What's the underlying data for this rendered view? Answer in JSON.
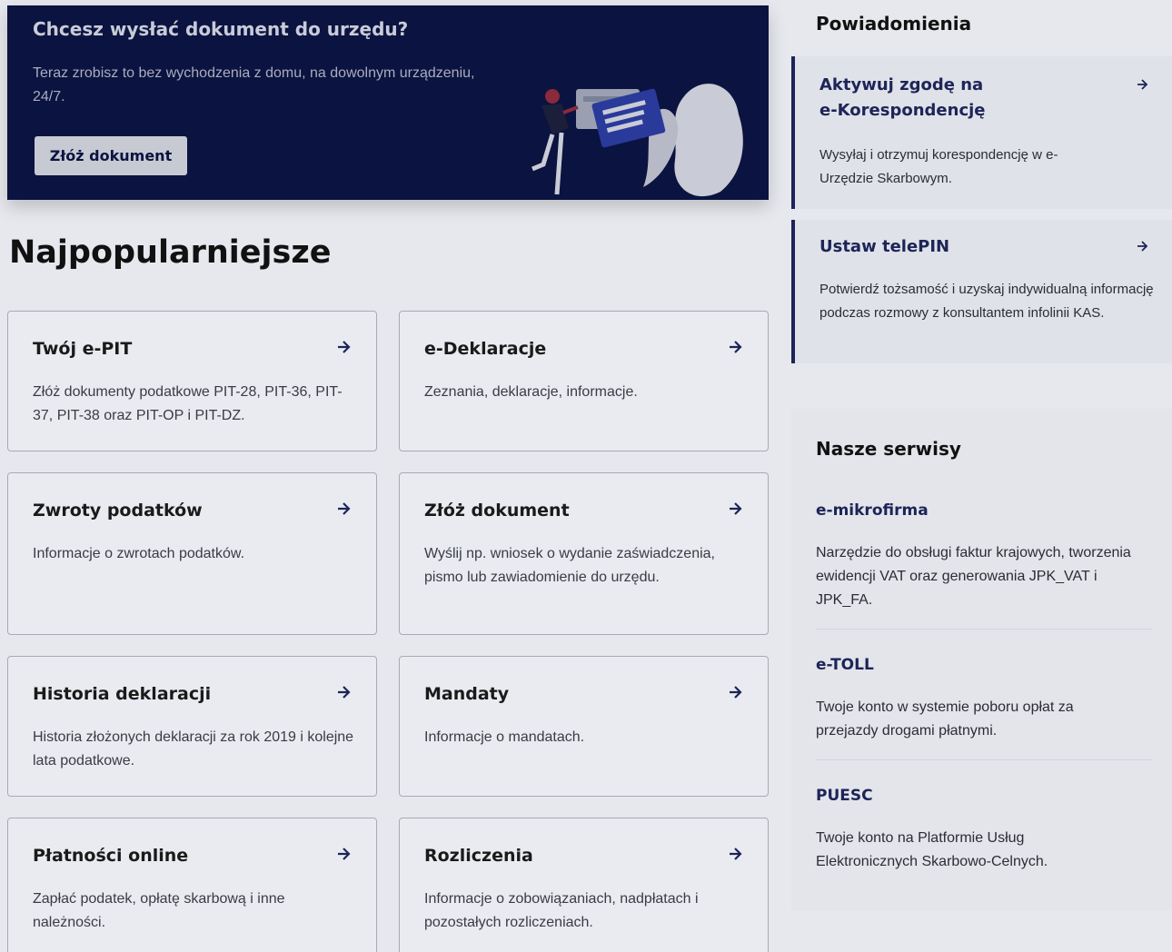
{
  "hero": {
    "title": "Chcesz wysłać dokument do urzędu?",
    "text": "Teraz zrobisz to bez wychodzenia z domu, na dowolnym urządzeniu, 24/7.",
    "button": "Złóż dokument"
  },
  "popular": {
    "title": "Najpopularniejsze",
    "cards": [
      {
        "title": "Twój e-PIT",
        "desc": "Złóż dokumenty podatkowe PIT-28, PIT-36, PIT-37, PIT-38 oraz PIT-OP i PIT-DZ."
      },
      {
        "title": "e-Deklaracje",
        "desc": "Zeznania, deklaracje, informacje."
      },
      {
        "title": "Zwroty podatków",
        "desc": "Informacje o zwrotach podatków."
      },
      {
        "title": "Złóż dokument",
        "desc": "Wyślij np. wniosek o wydanie zaświadczenia, pismo lub zawiadomienie do urzędu."
      },
      {
        "title": "Historia deklaracji",
        "desc": "Historia złożonych deklaracji za rok 2019 i kolejne lata podatkowe."
      },
      {
        "title": "Mandaty",
        "desc": "Informacje o mandatach."
      },
      {
        "title": "Płatności online",
        "desc": "Zapłać podatek, opłatę skarbową i inne należności."
      },
      {
        "title": "Rozliczenia",
        "desc": "Informacje o zobowiązaniach, nadpłatach i pozostałych rozliczeniach."
      }
    ]
  },
  "notifications": {
    "title": "Powiadomienia",
    "items": [
      {
        "title_line1": "Aktywuj zgodę na",
        "title_line2": "e-Korespondencję",
        "desc": "Wysyłaj i otrzymuj korespondencję w e-Urzędzie Skarbowym."
      },
      {
        "title_line1": "Ustaw telePIN",
        "desc": "Potwierdź tożsamość i uzyskaj indywidualną informację podczas rozmowy z konsultantem infolinii KAS."
      }
    ]
  },
  "services": {
    "title": "Nasze serwisy",
    "items": [
      {
        "name": "e-mikrofirma",
        "desc": "Narzędzie do obsługi faktur krajowych, tworzenia ewidencji VAT oraz generowania JPK_VAT i JPK_FA."
      },
      {
        "name": "e-TOLL",
        "desc": "Twoje konto w systemie poboru opłat za przejazdy drogami płatnymi."
      },
      {
        "name": "PUESC",
        "desc": "Twoje konto na Platformie Usług Elektronicznych Skarbowo-Celnych."
      }
    ]
  },
  "colors": {
    "navy": "#0b1340",
    "accent": "#1d2458"
  },
  "icons": {
    "card_arrow": "arrow-right-icon"
  }
}
